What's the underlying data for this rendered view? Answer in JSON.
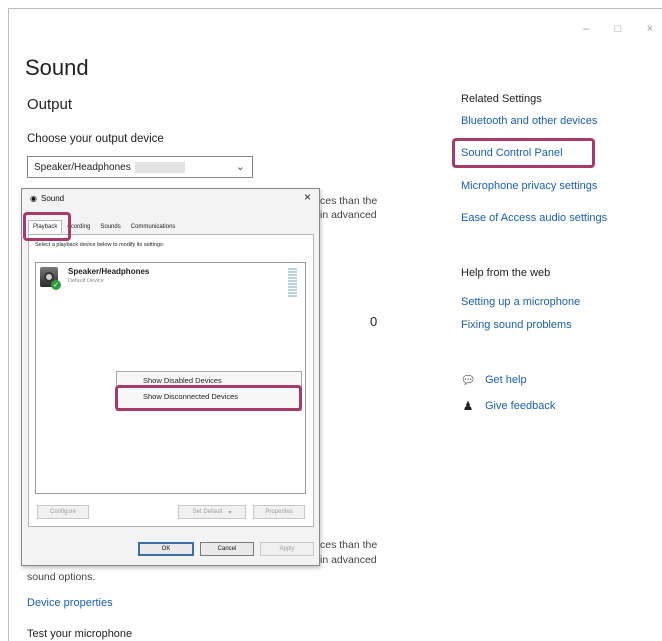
{
  "window": {
    "controls": [
      "–",
      "□",
      "×"
    ]
  },
  "page_title": "Sound",
  "output": {
    "section_title": "Output",
    "choose_label": "Choose your output device",
    "device_value": "Speaker/Headphones",
    "bg_text_1a": "ces than the",
    "bg_text_1b": "in advanced",
    "volume_value": "0",
    "bg_text_2a": "ces than the",
    "bg_text_2b": "in advanced",
    "bg_text_3": "sound options.",
    "device_properties": "Device properties",
    "test_microphone": "Test your microphone"
  },
  "related": {
    "title": "Related Settings",
    "links": [
      "Bluetooth and other devices",
      "Sound Control Panel",
      "Microphone privacy settings",
      "Ease of Access audio settings"
    ]
  },
  "help": {
    "title": "Help from the web",
    "links": [
      "Setting up a microphone",
      "Fixing sound problems"
    ],
    "get_help": "Get help",
    "give_feedback": "Give feedback"
  },
  "dialog": {
    "title": "Sound",
    "close": "×",
    "tabs": [
      "Playback",
      "ecording",
      "Sounds",
      "Communications"
    ],
    "instruction": "Select a playback device below to modify its settings:",
    "device_name": "Speaker/Headphones",
    "device_status": "Default Device",
    "context_menu": [
      "Show Disabled Devices",
      "Show Disconnected Devices"
    ],
    "buttons": {
      "configure": "Configure",
      "set_default": "Set Default",
      "properties": "Properties",
      "ok": "OK",
      "cancel": "Cancel",
      "apply": "Apply"
    }
  },
  "colors": {
    "link": "#1a5fb4",
    "highlight": "#a63a6b",
    "check": "#2e9e3a"
  }
}
